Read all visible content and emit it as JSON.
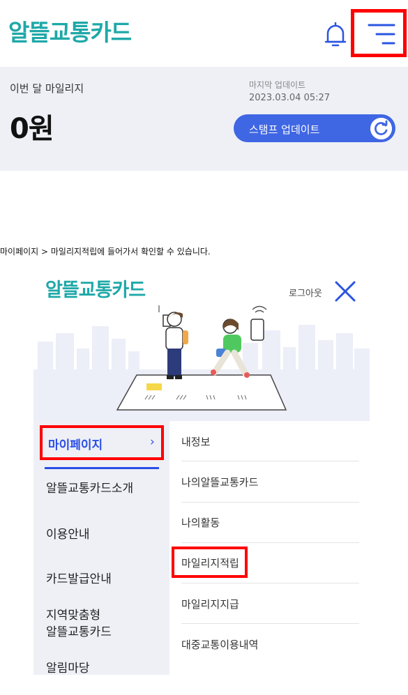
{
  "header": {
    "logo": "알뜰교통카드",
    "bell_icon": "bell-icon",
    "menu_icon": "hamburger-menu-icon",
    "highlight_color": "#ff0000"
  },
  "mileage": {
    "label": "이번 달 마일리지",
    "value": "0원",
    "update_label": "마지막 업데이트",
    "update_time": "2023.03.04 05:27",
    "stamp_button": "스탬프 업데이트",
    "accent": "#3f66e3"
  },
  "caption": "마이페이지 > 마일리지적립에 들어가서 확인할 수 있습니다.",
  "menu_panel": {
    "logo": "알뜰교통카드",
    "logout": "로그아웃",
    "close_icon": "close-icon",
    "sidebar": [
      {
        "label": "마이페이지",
        "active": true
      },
      {
        "label": "알뜰교통카드소개"
      },
      {
        "label": "이용안내"
      },
      {
        "label": "카드발급안내"
      },
      {
        "label": "지역맞춤형"
      },
      {
        "label": "알뜰교통카드"
      },
      {
        "label": "알림마당"
      }
    ],
    "submenu": [
      {
        "label": "내정보"
      },
      {
        "label": "나의알뜰교통카드"
      },
      {
        "label": "나의활동"
      },
      {
        "label": "마일리지적립",
        "highlighted": true
      },
      {
        "label": "마일리지지급"
      },
      {
        "label": "대중교통이용내역"
      }
    ]
  }
}
